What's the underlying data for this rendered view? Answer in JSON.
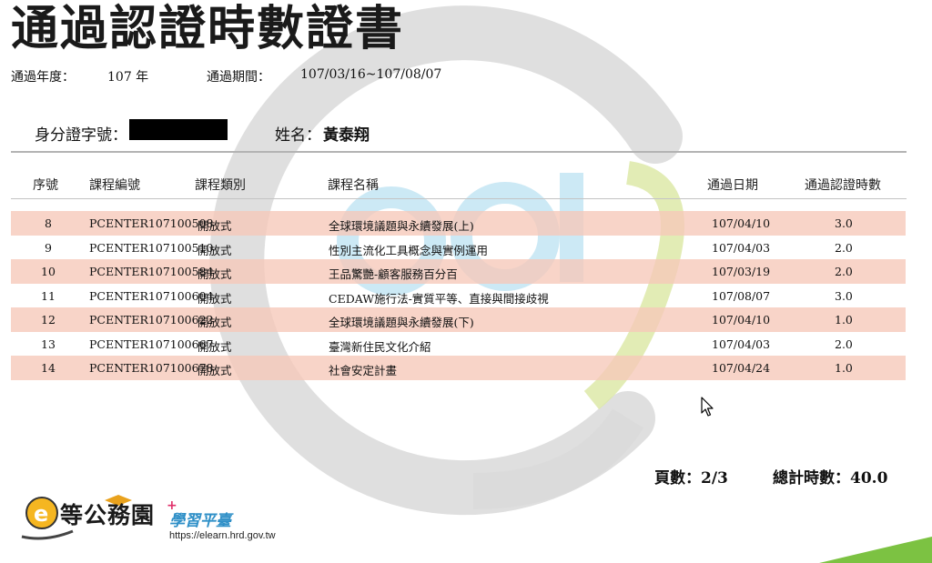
{
  "document": {
    "title": "通過認證時數證書",
    "year_label": "通過年度：",
    "year_value": "107 年",
    "period_label": "通過期間：",
    "period_value": "107/03/16~107/08/07",
    "id_label": "身分證字號：",
    "name_label": "姓名：",
    "name_value": "黃泰翔"
  },
  "table": {
    "headers": [
      "序號",
      "課程編號",
      "課程類別",
      "課程名稱",
      "通過日期",
      "通過認證時數"
    ],
    "rows": [
      {
        "seq": "8",
        "code": "PCENTER107100508",
        "type": "開放式",
        "name": "全球環境議題與永續發展(上)",
        "date": "107/04/10",
        "hours": "3.0"
      },
      {
        "seq": "9",
        "code": "PCENTER107100510",
        "type": "開放式",
        "name": "性別主流化工具概念與實例運用",
        "date": "107/04/03",
        "hours": "2.0"
      },
      {
        "seq": "10",
        "code": "PCENTER107100584",
        "type": "開放式",
        "name": "王品驚艷-顧客服務百分百",
        "date": "107/03/19",
        "hours": "2.0"
      },
      {
        "seq": "11",
        "code": "PCENTER107100604",
        "type": "開放式",
        "name": "CEDAW施行法-實質平等、直接與間接歧視",
        "date": "107/08/07",
        "hours": "3.0"
      },
      {
        "seq": "12",
        "code": "PCENTER107100622",
        "type": "開放式",
        "name": "全球環境議題與永續發展(下)",
        "date": "107/04/10",
        "hours": "1.0"
      },
      {
        "seq": "13",
        "code": "PCENTER107100667",
        "type": "開放式",
        "name": "臺灣新住民文化介紹",
        "date": "107/04/03",
        "hours": "2.0"
      },
      {
        "seq": "14",
        "code": "PCENTER107100678",
        "type": "開放式",
        "name": "社會安定計畫",
        "date": "107/04/24",
        "hours": "1.0"
      }
    ]
  },
  "footer": {
    "page_label": "頁數：2/3",
    "total_label": "總計時數：40.0"
  },
  "logo": {
    "main_text": "等公務園",
    "sub_text": "學習平臺",
    "url": "https://elearn.hrd.gov.tw"
  },
  "colors": {
    "row_alt": "#f6c8b9",
    "watermark_gray": "#cfcfcf",
    "watermark_blue": "#9fd3ee",
    "watermark_green": "#c9dc7c",
    "brand_blue": "#2e8fc7"
  }
}
